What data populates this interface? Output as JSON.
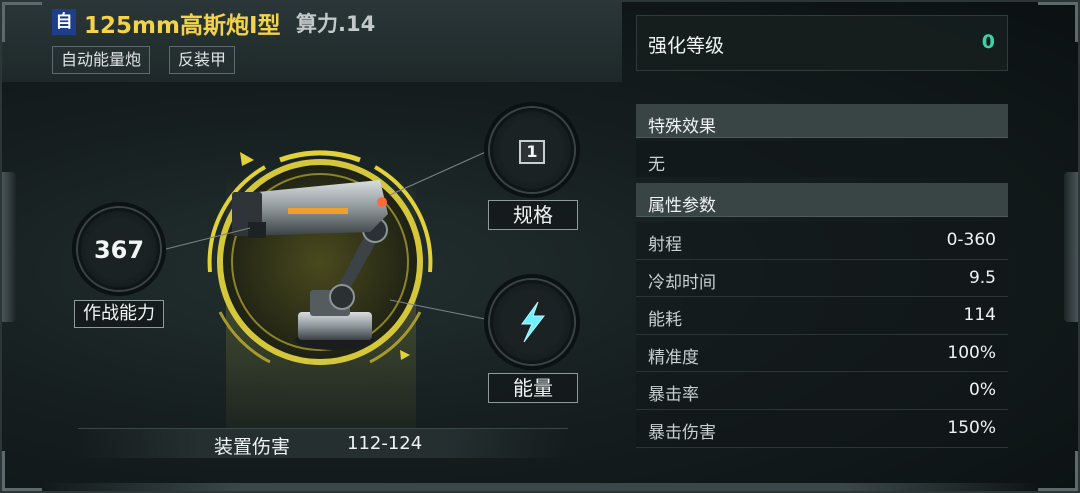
{
  "header": {
    "auto_badge": "自",
    "title": "125mm高斯炮Ⅰ型",
    "power": "算力.14",
    "tags": [
      "自动能量炮",
      "反装甲"
    ]
  },
  "stats": {
    "combat_value": "367",
    "combat_label": "作战能力",
    "spec_value": "1",
    "spec_label": "规格",
    "energy_label": "能量"
  },
  "damage": {
    "label": "装置伤害",
    "value": "112-124"
  },
  "enhance": {
    "label": "强化等级",
    "value": "0"
  },
  "special": {
    "title": "特殊效果",
    "value": "无"
  },
  "attributes": {
    "title": "属性参数",
    "rows": [
      {
        "name": "射程",
        "value": "0-360"
      },
      {
        "name": "冷却时间",
        "value": "9.5"
      },
      {
        "name": "能耗",
        "value": "114"
      },
      {
        "name": "精准度",
        "value": "100%"
      },
      {
        "name": "暴击率",
        "value": "0%"
      },
      {
        "name": "暴击伤害",
        "value": "150%"
      }
    ]
  },
  "colors": {
    "title_gold": "#f2d34a",
    "badge_blue": "#1e3d8a",
    "enhance_green": "#3fd0a3",
    "gauge_yellow": "#e2d23a",
    "energy_cyan": "#6ff0ff"
  },
  "icons": {
    "weapon": "gauss-cannon-turret-icon",
    "energy": "lightning-energy-icon"
  }
}
